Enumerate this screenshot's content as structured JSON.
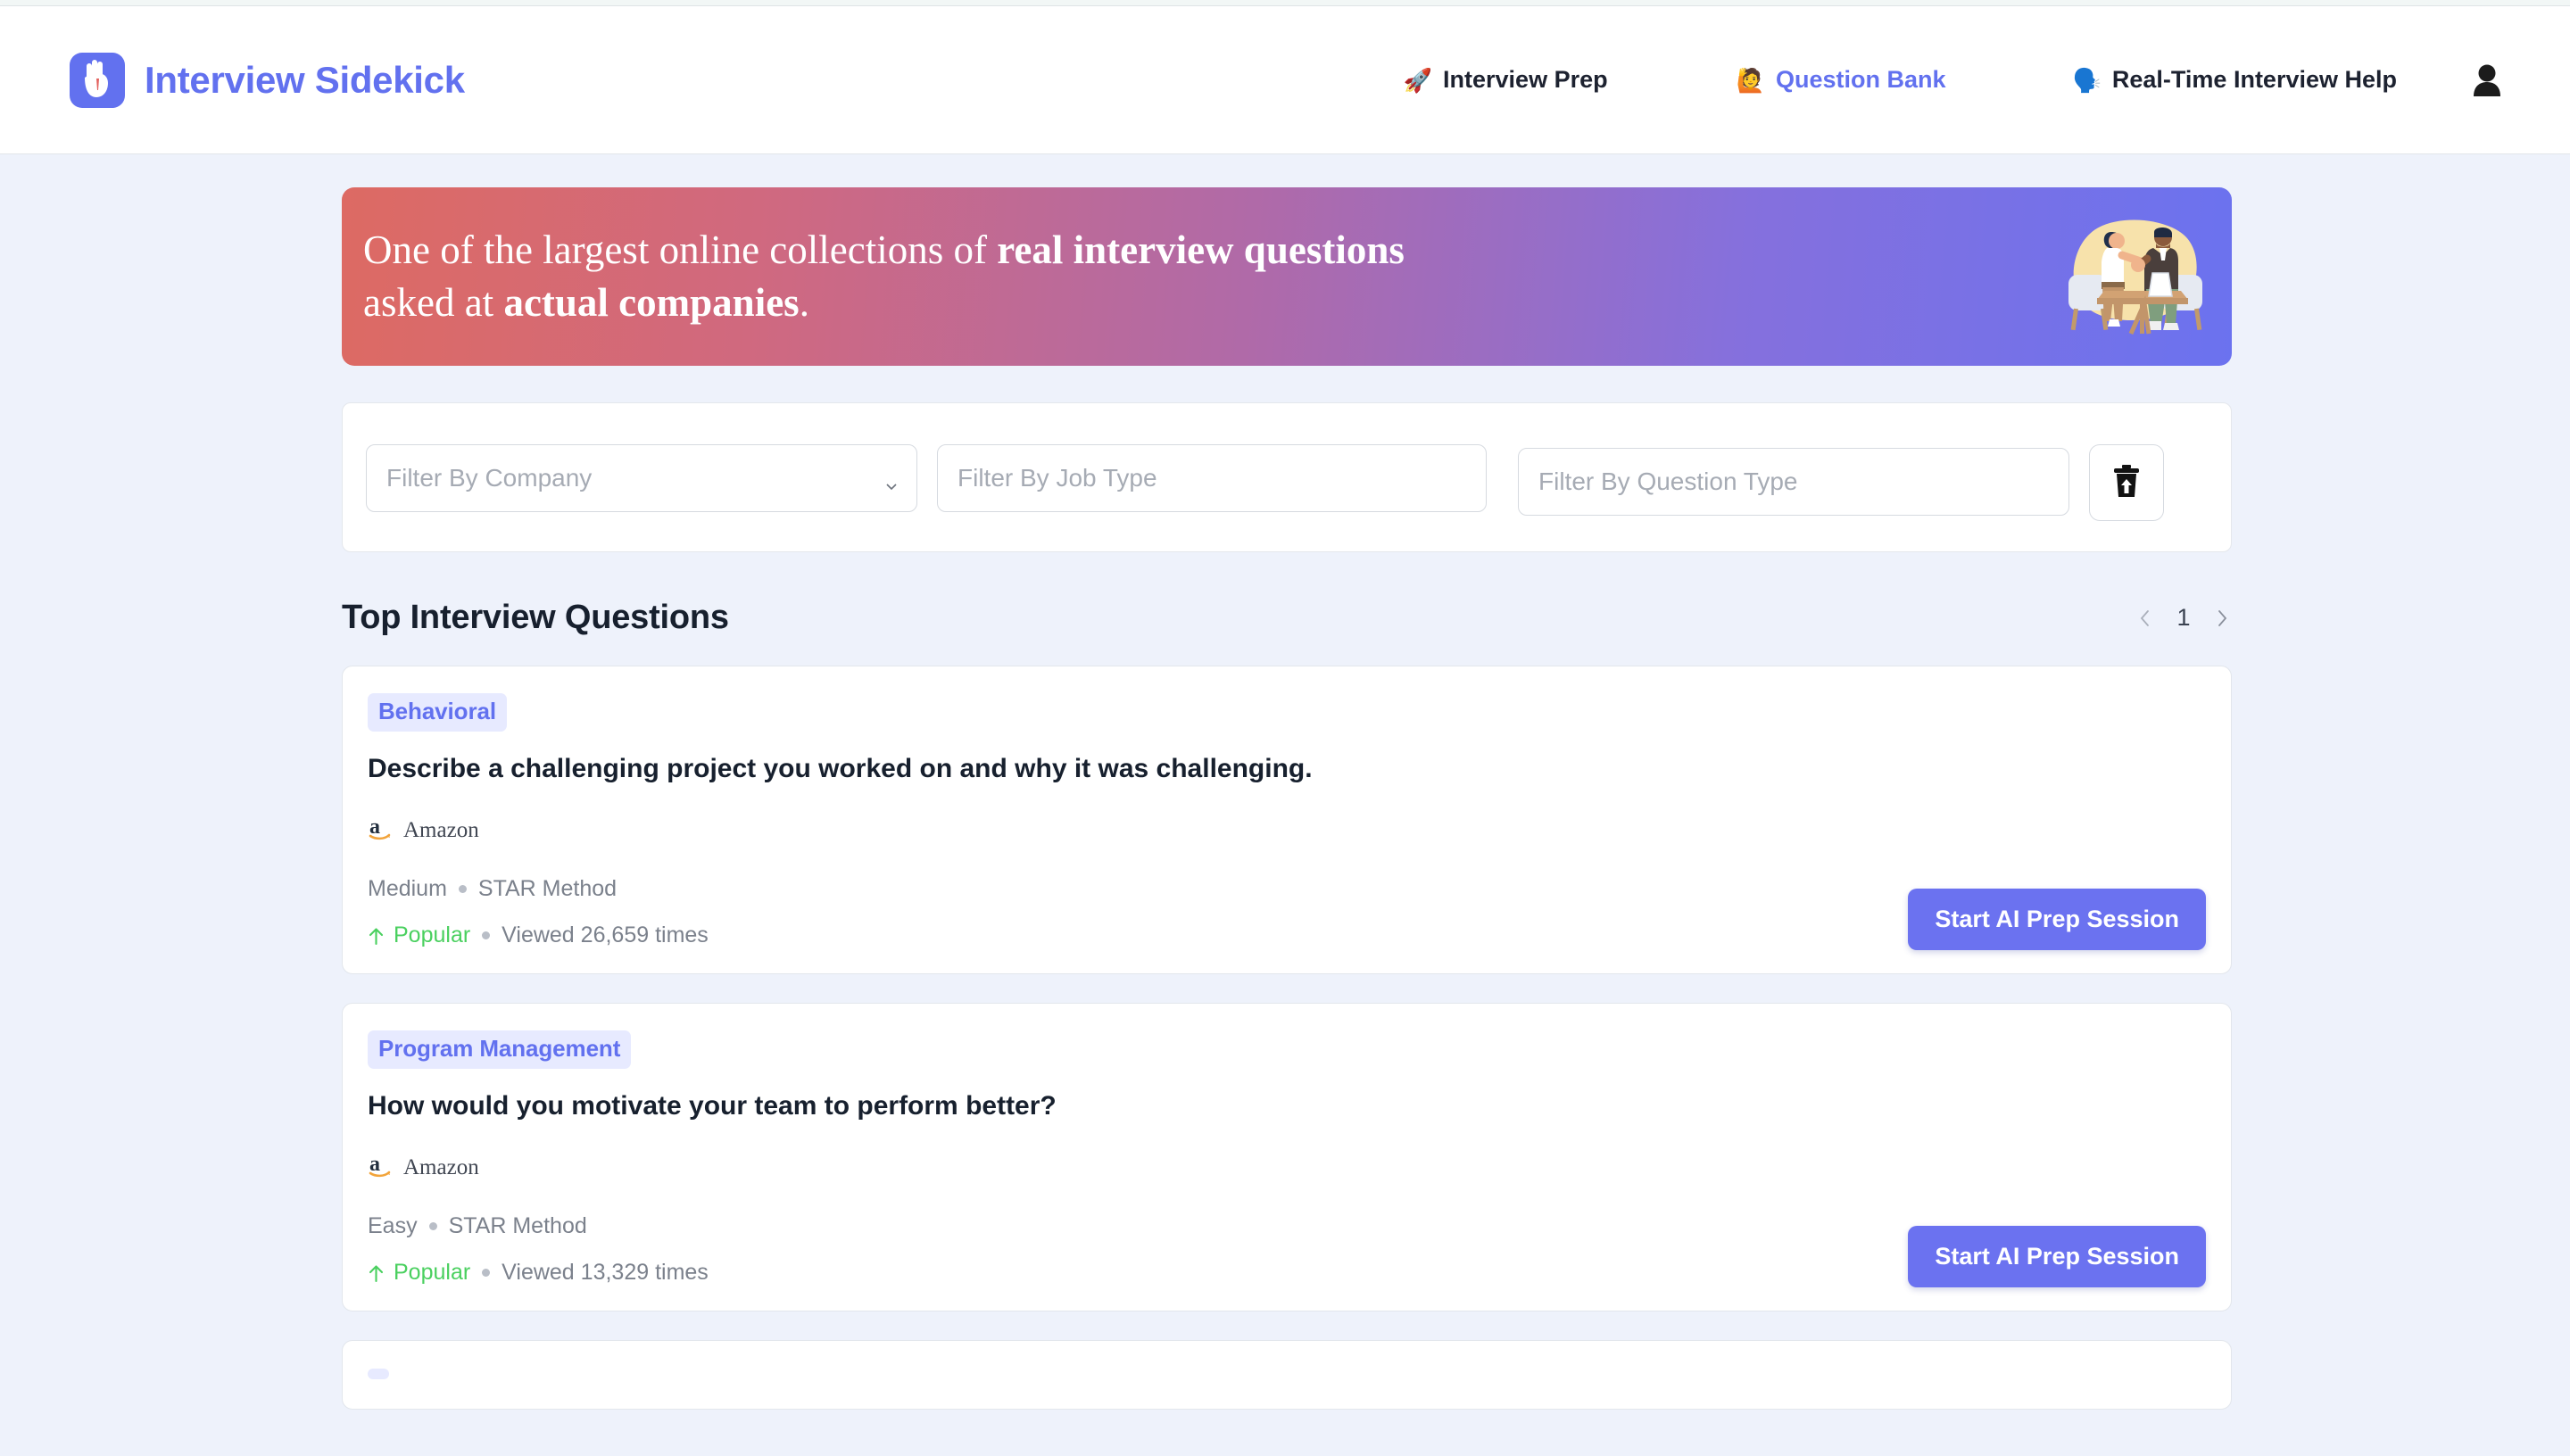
{
  "brand": {
    "name": "Interview Sidekick",
    "logo_icon": "hand-ok-logo-icon",
    "accent_color": "#6271ef"
  },
  "nav": {
    "items": [
      {
        "emoji": "🚀",
        "icon": "rocket-icon",
        "label": "Interview Prep",
        "active": false
      },
      {
        "emoji": "🙋",
        "icon": "person-raising-hand-icon",
        "label": "Question Bank",
        "active": true
      },
      {
        "emoji": "🗣️",
        "icon": "speaking-head-icon",
        "label": "Real-Time Interview Help",
        "active": false
      }
    ],
    "avatar_icon": "user-avatar-icon"
  },
  "hero": {
    "line1_plain": "One of the largest online collections of ",
    "line1_bold": "real interview questions",
    "line2_plain": "asked at ",
    "line2_bold": "actual companies",
    "line2_end": ".",
    "illustration": "handshake-interview-illustration",
    "gradient_from": "#dd6a63",
    "gradient_to": "#6b72ef"
  },
  "filters": {
    "company": {
      "placeholder": "Filter By Company",
      "value": "",
      "type": "select"
    },
    "job_type": {
      "placeholder": "Filter By Job Type",
      "value": "",
      "type": "text"
    },
    "question_type": {
      "placeholder": "Filter By Question Type",
      "value": "",
      "type": "text"
    },
    "clear_icon": "trash-upload-icon"
  },
  "section": {
    "title": "Top Interview Questions",
    "pagination": {
      "prev_icon": "chevron-left-icon",
      "page": "1",
      "next_icon": "chevron-right-icon"
    }
  },
  "cards": [
    {
      "badge": "Behavioral",
      "question": "Describe a challenging project you worked on and why it was challenging.",
      "company": "Amazon",
      "company_icon": "amazon-logo-icon",
      "difficulty": "Medium",
      "method": "STAR Method",
      "popular_label": "Popular",
      "popular_icon": "arrow-up-icon",
      "views": "Viewed 26,659 times",
      "cta": "Start AI Prep Session"
    },
    {
      "badge": "Program Management",
      "question": "How would you motivate your team to perform better?",
      "company": "Amazon",
      "company_icon": "amazon-logo-icon",
      "difficulty": "Easy",
      "method": "STAR Method",
      "popular_label": "Popular",
      "popular_icon": "arrow-up-icon",
      "views": "Viewed 13,329 times",
      "cta": "Start AI Prep Session"
    },
    {
      "badge": "",
      "question": "",
      "company": "",
      "company_icon": "amazon-logo-icon",
      "difficulty": "",
      "method": "",
      "popular_label": "",
      "popular_icon": "arrow-up-icon",
      "views": "",
      "cta": ""
    }
  ]
}
